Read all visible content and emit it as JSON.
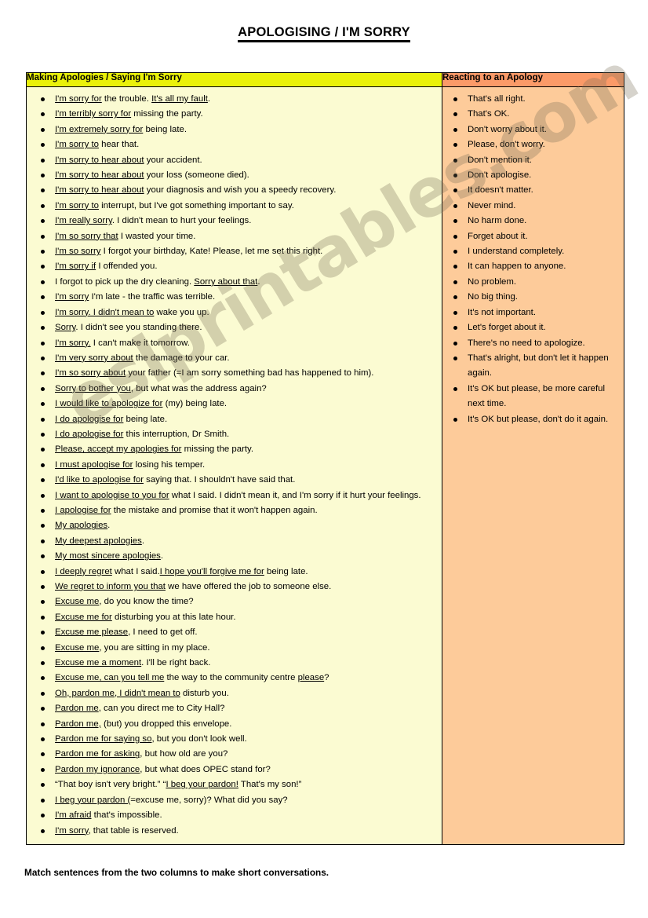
{
  "document": {
    "title": "APOLOGISING / I'M SORRY",
    "footer_note": "Match sentences from the two columns to make short conversations.",
    "watermark": "eslprintables.com"
  },
  "colors": {
    "left_header_bg": "#eaf10a",
    "right_header_bg": "#fb9a68",
    "left_body_bg": "#fbfbd2",
    "right_body_bg": "#fdcb9a",
    "border": "#000000",
    "text": "#000000"
  },
  "table": {
    "columns": [
      {
        "header": "Making Apologies / Saying I'm Sorry"
      },
      {
        "header": "Reacting to an Apology"
      }
    ],
    "left_items": [
      [
        {
          "t": "I'm sorry for",
          "u": true
        },
        {
          "t": " the trouble. ",
          "u": false
        },
        {
          "t": "It's all my fault",
          "u": true
        },
        {
          "t": ".",
          "u": false
        }
      ],
      [
        {
          "t": "I'm terribly sorry for",
          "u": true
        },
        {
          "t": " missing the party.",
          "u": false
        }
      ],
      [
        {
          "t": "I'm extremely sorry for",
          "u": true
        },
        {
          "t": " being late.",
          "u": false
        }
      ],
      [
        {
          "t": "I'm sorry to",
          "u": true
        },
        {
          "t": " hear that.",
          "u": false
        }
      ],
      [
        {
          "t": "I'm sorry to hear about",
          "u": true
        },
        {
          "t": " your accident.",
          "u": false
        }
      ],
      [
        {
          "t": "I'm sorry to hear about",
          "u": true
        },
        {
          "t": " your loss (someone died).",
          "u": false
        }
      ],
      [
        {
          "t": "I'm sorry to hear about",
          "u": true
        },
        {
          "t": " your diagnosis and wish you a speedy recovery.",
          "u": false
        }
      ],
      [
        {
          "t": "I'm sorry to",
          "u": true
        },
        {
          "t": " interrupt, but I've got something important to say.",
          "u": false
        }
      ],
      [
        {
          "t": "I'm really sorry",
          "u": true
        },
        {
          "t": ". I didn't mean to hurt your feelings.",
          "u": false
        }
      ],
      [
        {
          "t": "I'm so sorry that",
          "u": true
        },
        {
          "t": " I wasted your time.",
          "u": false
        }
      ],
      [
        {
          "t": "I'm so sorry",
          "u": true
        },
        {
          "t": " I forgot your birthday, Kate! Please, let me set this right.",
          "u": false
        }
      ],
      [
        {
          "t": "I'm sorry if",
          "u": true
        },
        {
          "t": " I offended you.",
          "u": false
        }
      ],
      [
        {
          "t": "I forgot to pick up the dry cleaning. ",
          "u": false
        },
        {
          "t": "Sorry about that",
          "u": true
        },
        {
          "t": ".",
          "u": false
        }
      ],
      [
        {
          "t": "I'm sorry",
          "u": true
        },
        {
          "t": " I'm late - the traffic was terrible.",
          "u": false
        }
      ],
      [
        {
          "t": "I'm sorry. I didn't mean to",
          "u": true
        },
        {
          "t": " wake you up.",
          "u": false
        }
      ],
      [
        {
          "t": "Sorry",
          "u": true
        },
        {
          "t": ". I didn't see you standing there.",
          "u": false
        }
      ],
      [
        {
          "t": "I'm sorry.",
          "u": true
        },
        {
          "t": " I can't make it tomorrow.",
          "u": false
        }
      ],
      [
        {
          "t": "I'm very sorry about",
          "u": true
        },
        {
          "t": " the damage to your car.",
          "u": false
        }
      ],
      [
        {
          "t": "I'm so sorry about",
          "u": true
        },
        {
          "t": " your father (=I am sorry something bad has happened to him).",
          "u": false
        }
      ],
      [
        {
          "t": "Sorry to bother you",
          "u": true
        },
        {
          "t": ", but what was the address again?",
          "u": false
        }
      ],
      [
        {
          "t": "I would like to apologize for",
          "u": true
        },
        {
          "t": " (my) being late.",
          "u": false
        }
      ],
      [
        {
          "t": "I do apologise for",
          "u": true
        },
        {
          "t": " being late.",
          "u": false
        }
      ],
      [
        {
          "t": "I do apologise for",
          "u": true
        },
        {
          "t": " this interruption, Dr Smith.",
          "u": false
        }
      ],
      [
        {
          "t": "Please, accept my apologies for",
          "u": true
        },
        {
          "t": " missing the party.",
          "u": false
        }
      ],
      [
        {
          "t": "I must apologise for",
          "u": true
        },
        {
          "t": " losing his temper.",
          "u": false
        }
      ],
      [
        {
          "t": "I'd like to apologise for",
          "u": true
        },
        {
          "t": " saying that. I shouldn't have said that.",
          "u": false
        }
      ],
      [
        {
          "t": "I want to apologise to you for",
          "u": true
        },
        {
          "t": " what I said. I didn't mean it, and I'm sorry if it hurt your feelings.",
          "u": false
        }
      ],
      [
        {
          "t": "I apologise for",
          "u": true
        },
        {
          "t": " the mistake and promise that it won't happen again.",
          "u": false
        }
      ],
      [
        {
          "t": "My apologies",
          "u": true
        },
        {
          "t": ".",
          "u": false
        }
      ],
      [
        {
          "t": "My deepest apologies",
          "u": true
        },
        {
          "t": ".",
          "u": false
        }
      ],
      [
        {
          "t": "My most sincere apologies",
          "u": true
        },
        {
          "t": ".",
          "u": false
        }
      ],
      [
        {
          "t": "I deeply regret",
          "u": true
        },
        {
          "t": " what I said.",
          "u": false
        },
        {
          "t": "I hope you'll forgive me for",
          "u": true
        },
        {
          "t": " being late.",
          "u": false
        }
      ],
      [
        {
          "t": "We regret to inform you that",
          "u": true
        },
        {
          "t": " we have offered the job to someone else.",
          "u": false
        }
      ],
      [
        {
          "t": "Excuse me",
          "u": true
        },
        {
          "t": ", do you know the time?",
          "u": false
        }
      ],
      [
        {
          "t": "Excuse me for",
          "u": true
        },
        {
          "t": " disturbing you at this late hour.",
          "u": false
        }
      ],
      [
        {
          "t": "Excuse me please",
          "u": true
        },
        {
          "t": ", I need to get off.",
          "u": false
        }
      ],
      [
        {
          "t": "Excuse me",
          "u": true
        },
        {
          "t": ", you are sitting in my place.",
          "u": false
        }
      ],
      [
        {
          "t": "Excuse me a moment",
          "u": true
        },
        {
          "t": ". I'll be right back.",
          "u": false
        }
      ],
      [
        {
          "t": "Excuse me, can you tell me",
          "u": true
        },
        {
          "t": " the way to the community centre ",
          "u": false
        },
        {
          "t": "please",
          "u": true
        },
        {
          "t": "?",
          "u": false
        }
      ],
      [
        {
          "t": "Oh, pardon me, I didn't mean to",
          "u": true
        },
        {
          "t": " disturb you.",
          "u": false
        }
      ],
      [
        {
          "t": "Pardon me",
          "u": true
        },
        {
          "t": ", can you direct me to City Hall?",
          "u": false
        }
      ],
      [
        {
          "t": "Pardon me,",
          "u": true
        },
        {
          "t": " (but) you dropped this envelope.",
          "u": false
        }
      ],
      [
        {
          "t": "Pardon me for saying so",
          "u": true
        },
        {
          "t": ", but you don't look well.",
          "u": false
        }
      ],
      [
        {
          "t": "Pardon me for asking",
          "u": true
        },
        {
          "t": ", but how old are you?",
          "u": false
        }
      ],
      [
        {
          "t": "Pardon my ignorance",
          "u": true
        },
        {
          "t": ", but what does OPEC stand for?",
          "u": false
        }
      ],
      [
        {
          "t": " “That boy isn't very bright.” “",
          "u": false
        },
        {
          "t": "I beg your pardon!",
          "u": true
        },
        {
          "t": " That's my son!”",
          "u": false
        }
      ],
      [
        {
          "t": "I beg your pardon (",
          "u": true
        },
        {
          "t": "=excuse me, sorry)? What did you say?",
          "u": false
        }
      ],
      [
        {
          "t": "I'm afraid",
          "u": true
        },
        {
          "t": " that's impossible.",
          "u": false
        }
      ],
      [
        {
          "t": "I'm sorry",
          "u": true
        },
        {
          "t": ", that table is reserved.",
          "u": false
        }
      ]
    ],
    "right_items": [
      "That's all right.",
      "That's OK.",
      "Don't worry about it.",
      "Please, don't worry.",
      "Don't mention it.",
      "Don't apologise.",
      "It doesn't matter.",
      "Never mind.",
      "No harm done.",
      "Forget about it.",
      "I understand completely.",
      "It can happen to anyone.",
      "No problem.",
      "No big thing.",
      "It's not important.",
      "Let's forget about it.",
      "There's no need to apologize.",
      "That's alright, but don't let it happen again.",
      "It's OK but please, be more careful next time.",
      "It's OK but please, don't do it again."
    ]
  }
}
